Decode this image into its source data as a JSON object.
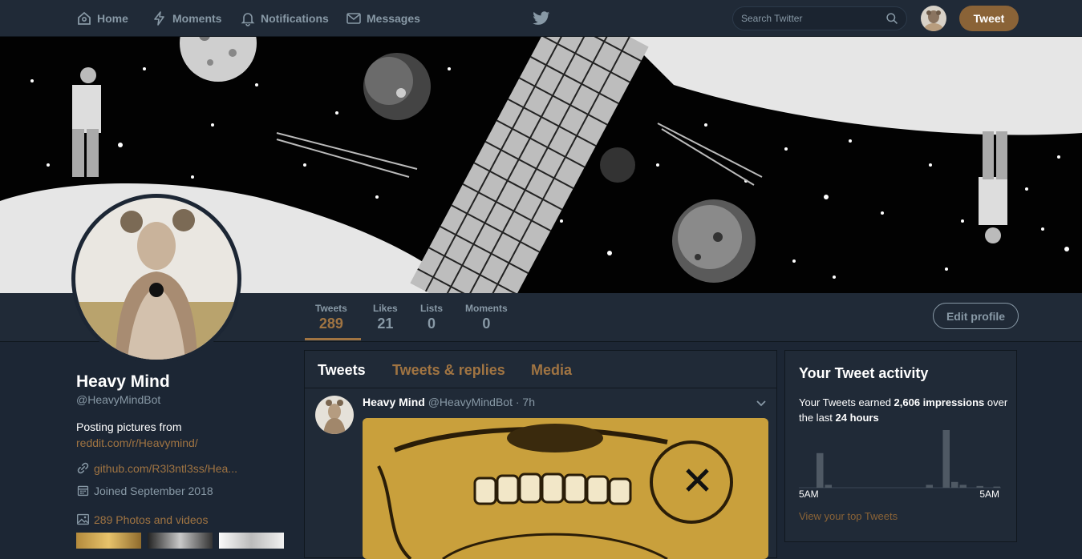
{
  "nav": {
    "home": "Home",
    "moments": "Moments",
    "notifications": "Notifications",
    "messages": "Messages",
    "search_placeholder": "Search Twitter",
    "tweet_button": "Tweet"
  },
  "profile": {
    "name": "Heavy Mind",
    "handle": "@HeavyMindBot",
    "bio_text": "Posting pictures from",
    "bio_link": "reddit.com/r/Heavymind/",
    "website": "github.com/R3l3ntl3ss/Hea...",
    "joined": "Joined September 2018",
    "photos": "289 Photos and videos",
    "edit_button": "Edit profile"
  },
  "stats": [
    {
      "label": "Tweets",
      "value": "289"
    },
    {
      "label": "Likes",
      "value": "21"
    },
    {
      "label": "Lists",
      "value": "0"
    },
    {
      "label": "Moments",
      "value": "0"
    }
  ],
  "tabs": [
    "Tweets",
    "Tweets & replies",
    "Media"
  ],
  "tweet": {
    "name": "Heavy Mind",
    "handle": "@HeavyMindBot",
    "time": "· 7h"
  },
  "activity": {
    "title": "Your Tweet activity",
    "text_before": "Your Tweets earned ",
    "impressions": "2,606 impressions",
    "text_mid": " over the last ",
    "period": "24 hours",
    "axis_start": "5AM",
    "axis_end": "5AM",
    "view_top": "View your top Tweets",
    "hourly_bars": [
      0,
      0,
      0.6,
      0.05,
      0,
      0,
      0,
      0,
      0,
      0,
      0,
      0,
      0,
      0,
      0,
      0.05,
      0,
      1.0,
      0.1,
      0.05,
      0,
      0.03,
      0,
      0.02
    ]
  },
  "colors": {
    "accent": "#a07442",
    "button": "#8a6337",
    "background": "#1c2634",
    "panel": "#202a37"
  }
}
